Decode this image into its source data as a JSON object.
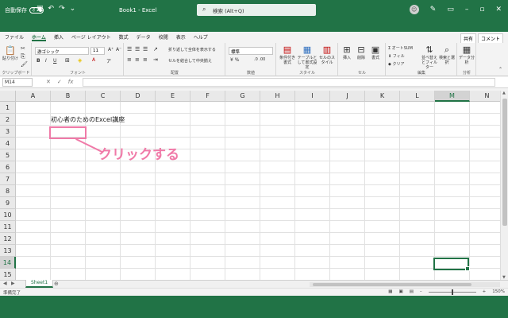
{
  "titlebar": {
    "autosave_label": "自動保存",
    "autosave_state": "オフ",
    "doc_title": "Book1 - Excel",
    "search_placeholder": "検索 (Alt+Q)"
  },
  "tabs": [
    "ファイル",
    "ホーム",
    "挿入",
    "ページ レイアウト",
    "数式",
    "データ",
    "校閲",
    "表示",
    "ヘルプ"
  ],
  "active_tab": "ホーム",
  "share_label": "共有",
  "comment_label": "コメント",
  "ribbon": {
    "clipboard": {
      "paste": "貼り付け",
      "label": "クリップボード"
    },
    "font": {
      "name": "游ゴシック",
      "size": "11",
      "label": "フォント",
      "bold": "B",
      "italic": "I",
      "underline": "U"
    },
    "alignment": {
      "wrap": "折り返して全体を表示する",
      "merge": "セルを結合して中央揃え",
      "label": "配置"
    },
    "number": {
      "format": "標準",
      "label": "数値"
    },
    "styles": {
      "conditional": "条件付き書式",
      "table": "テーブルとして書式設定",
      "cell": "セルのスタイル",
      "label": "スタイル"
    },
    "cells": {
      "insert": "挿入",
      "delete": "削除",
      "format": "書式",
      "label": "セル"
    },
    "editing": {
      "autosum": "オートSUM",
      "fill": "フィル",
      "clear": "クリア",
      "sort": "並べ替えとフィルター",
      "find": "検索と選択",
      "label": "編集"
    },
    "analysis": {
      "data": "データ分析",
      "label": "分析"
    }
  },
  "formula_bar": {
    "name_box": "M14",
    "fx": "fx"
  },
  "columns": [
    "A",
    "B",
    "C",
    "D",
    "E",
    "F",
    "G",
    "H",
    "I",
    "J",
    "K",
    "L",
    "M",
    "N"
  ],
  "rows": [
    "1",
    "2",
    "3",
    "4",
    "5",
    "6",
    "7",
    "8",
    "9",
    "10",
    "11",
    "12",
    "13",
    "14",
    "15"
  ],
  "selected_column": "M",
  "selected_row": "14",
  "cell_b2": "初心者のためのExcel講座",
  "annotation": "クリックする",
  "sheet_tab": "Sheet1",
  "status": {
    "ready": "準備完了",
    "zoom": "150%"
  },
  "colors": {
    "excel_green": "#217346",
    "annotation_pink": "#f07aa8"
  }
}
